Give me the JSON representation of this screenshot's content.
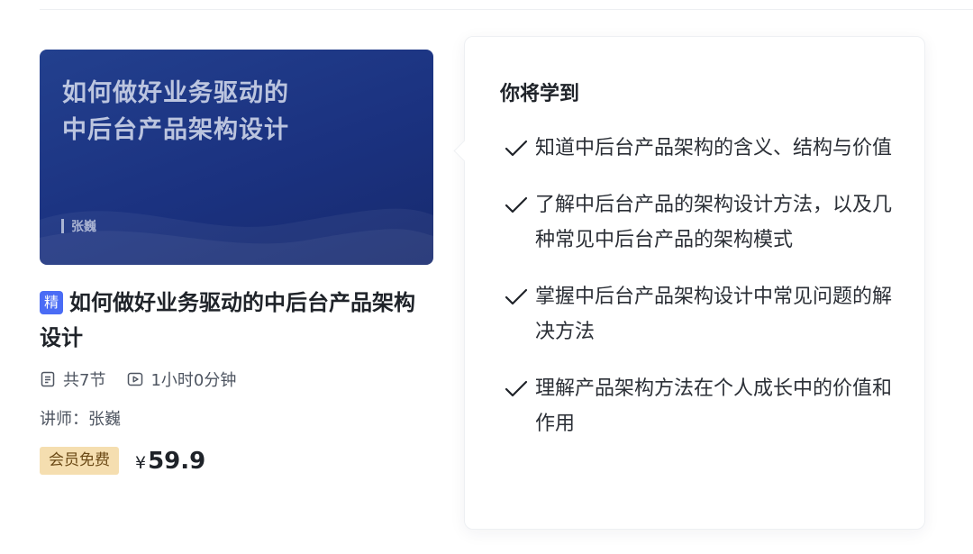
{
  "course": {
    "cover": {
      "title_line1": "如何做好业务驱动的",
      "title_line2": "中后台产品架构设计",
      "author": "张巍"
    },
    "badge": "精",
    "title": "如何做好业务驱动的中后台产品架构设计",
    "lessons": "共7节",
    "duration": "1小时0分钟",
    "lecturer": "讲师：张巍",
    "vip_tag": "会员免费",
    "currency": "¥",
    "price": "59.9"
  },
  "popover": {
    "heading": "你将学到",
    "items": [
      "知道中后台产品架构的含义、结构与价值",
      "了解中后台产品的架构设计方法，以及几种常见中后台产品的架构模式",
      "掌握中后台产品架构设计中常见问题的解决方法",
      "理解产品架构方法在个人成长中的价值和作用"
    ]
  },
  "icons": {
    "lessons": "list-doc-icon",
    "duration": "play-icon",
    "check": "checkmark-icon"
  },
  "colors": {
    "accent": "#4a6cf5",
    "cover_bg": "#1b3280",
    "vip_bg": "#f5deb0",
    "vip_text": "#6c4a16"
  }
}
